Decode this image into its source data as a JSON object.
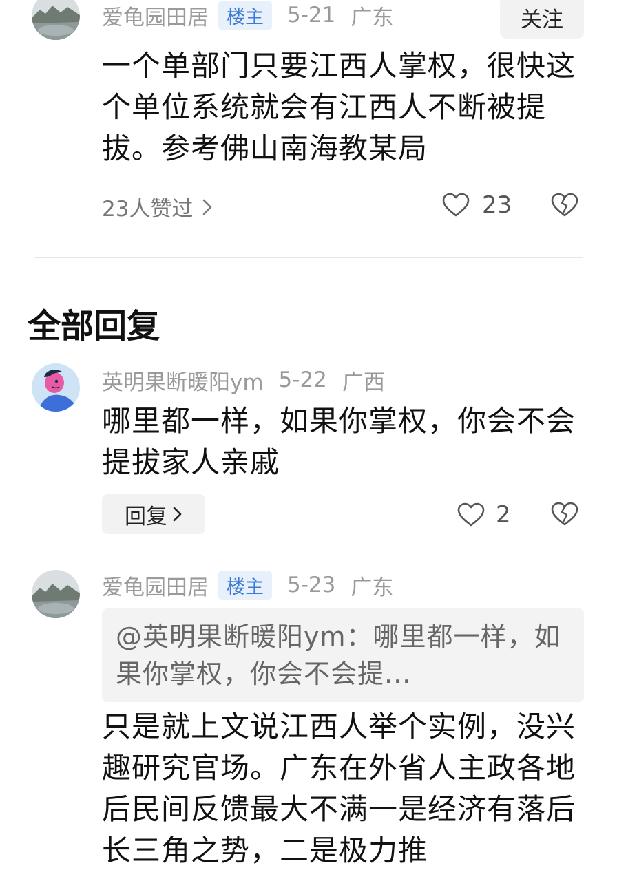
{
  "top_post": {
    "username": "爱龟园田居",
    "badge": "楼主",
    "date": "5-21",
    "region": "广东",
    "follow_label": "关注",
    "content": "一个单部门只要江西人掌权，很快这个单位系统就会有江西人不断被提拔。参考佛山南海教某局",
    "likes_summary": "23人赞过",
    "like_count": "23"
  },
  "section": {
    "title": "全部回复"
  },
  "replies": [
    {
      "username": "英明果断暖阳ym",
      "date": "5-22",
      "region": "广西",
      "content": "哪里都一样，如果你掌权，你会不会提拔家人亲戚",
      "reply_label": "回复",
      "like_count": "2"
    },
    {
      "username": "爱龟园田居",
      "badge": "楼主",
      "date": "5-23",
      "region": "广东",
      "quote": "@英明果断暖阳ym：哪里都一样，如果你掌权，你会不会提...",
      "content": "只是就上文说江西人举个实例，没兴趣研究官场。广东在外省人主政各地后民间反馈最大不满一是经济有落后长三角之势，二是极力推"
    }
  ],
  "icons": {
    "like": "heart-icon",
    "dislike": "broken-heart-icon",
    "chevron": "chevron-right-icon"
  },
  "colors": {
    "badge_bg": "#e8f1fb",
    "badge_text": "#3a7bd5",
    "meta_text": "#999999"
  }
}
